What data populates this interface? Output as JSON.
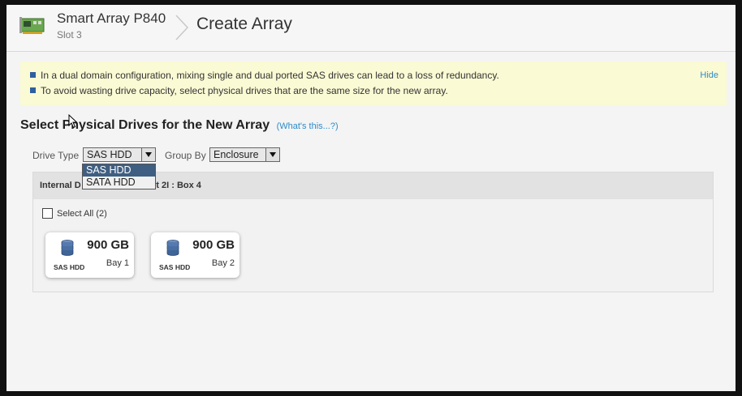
{
  "header": {
    "controller_name": "Smart Array P840",
    "slot": "Slot 3",
    "page_title": "Create Array"
  },
  "notice": {
    "lines": [
      "In a dual domain configuration, mixing single and dual ported SAS drives can lead to a loss of redundancy.",
      "To avoid wasting drive capacity, select physical drives that are the same size for the new array."
    ],
    "hide_label": "Hide"
  },
  "section": {
    "title": "Select Physical Drives for the New Array",
    "help_link": "(What's this...?)"
  },
  "filters": {
    "drive_type_label": "Drive Type",
    "drive_type_value": "SAS HDD",
    "drive_type_options": [
      "SAS HDD",
      "SATA HDD"
    ],
    "group_by_label": "Group By",
    "group_by_value": "Enclosure"
  },
  "panel": {
    "title_left": "Internal D",
    "title_right": "rt 2I : Box 4",
    "select_all_label": "Select All (2)",
    "drives": [
      {
        "type": "SAS HDD",
        "size": "900 GB",
        "bay": "Bay 1"
      },
      {
        "type": "SAS HDD",
        "size": "900 GB",
        "bay": "Bay 2"
      }
    ]
  },
  "colors": {
    "notice_bg": "#fafad4",
    "link": "#2e8bc9",
    "bullet": "#2f5f9f",
    "dropdown_selected": "#3f5f82"
  }
}
